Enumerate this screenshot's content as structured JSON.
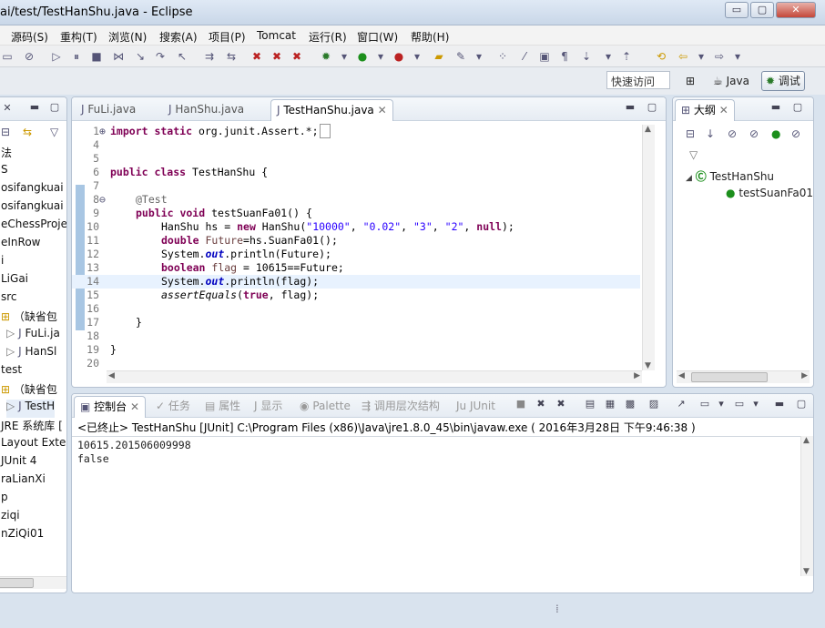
{
  "window": {
    "title": "ai/test/TestHanShu.java  -  Eclipse",
    "minimize_glyph": "▭",
    "maximize_glyph": "▢",
    "close_glyph": "✕"
  },
  "menu": [
    "源码(S)",
    "重构(T)",
    "浏览(N)",
    "搜索(A)",
    "项目(P)",
    "Tomcat",
    "运行(R)",
    "窗口(W)",
    "帮助(H)"
  ],
  "toolbar": {
    "quick_access": "快速访问"
  },
  "perspectives": {
    "java": "Java",
    "debug": "调试"
  },
  "explorer": {
    "items": [
      "法",
      "S",
      "osifangkuai",
      "osifangkuai",
      "eChessProjec",
      "eInRow",
      "i",
      "LiGai",
      "src",
      "（缺省包",
      "FuLi.ja",
      "HanSl",
      "test",
      "（缺省包",
      "TestH",
      "JRE 系统库 [",
      "Layout Exter",
      "JUnit 4",
      "raLianXi",
      "p",
      "ziqi",
      "nZiQi01"
    ]
  },
  "editor": {
    "tabs": [
      {
        "label": "FuLi.java"
      },
      {
        "label": "HanShu.java"
      },
      {
        "label": "TestHanShu.java"
      }
    ],
    "line_numbers": [
      "1",
      "4",
      "5",
      "6",
      "7",
      "8",
      "9",
      "10",
      "11",
      "12",
      "13",
      "14",
      "15",
      "16",
      "17",
      "18",
      "19",
      "20"
    ],
    "code": {
      "l1_kw": "import static",
      "l1_rest": " org.junit.Assert.*;",
      "l6_kw": "public class",
      "l6_rest": " TestHanShu {",
      "l8_ann": "@Test",
      "l9_kw": "public void",
      "l9_rest": " testSuanFa01() {",
      "l10_a": "HanShu hs = ",
      "l10_new": "new",
      "l10_b": " HanShu(",
      "l10_s1": "\"10000\"",
      "l10_c1": ", ",
      "l10_s2": "\"0.02\"",
      "l10_c2": ", ",
      "l10_s3": "\"3\"",
      "l10_c3": ", ",
      "l10_s4": "\"2\"",
      "l10_c4": ", ",
      "l10_null": "null",
      "l10_end": ");",
      "l11_kw": "double",
      "l11_var": " Future",
      "l11_rest": "=hs.SuanFa01();",
      "l12_a": "System.",
      "l12_out": "out",
      "l12_b": ".println(Future);",
      "l13_kw": "boolean",
      "l13_var": " flag",
      "l13_rest": " = 10615==Future;",
      "l14_a": "System.",
      "l14_out": "out",
      "l14_b": ".println(flag);",
      "l15_call": "assertEquals",
      "l15_a": "(",
      "l15_true": "true",
      "l15_b": ", flag);",
      "l17": "}",
      "l19": "}"
    }
  },
  "outline": {
    "tab": "大纲",
    "class_name": "TestHanShu",
    "method_name": "testSuanFa01"
  },
  "console": {
    "tabs": [
      "控制台",
      "任务",
      "属性",
      "显示",
      "Palette",
      "调用层次结构",
      "JUnit"
    ],
    "status": "<已终止> TestHanShu [JUnit] C:\\Program Files (x86)\\Java\\jre1.8.0_45\\bin\\javaw.exe ( 2016年3月28日 下午9:46:38 )",
    "output": [
      "10615.201506009998",
      "false"
    ]
  },
  "colors": {
    "keyword": "#7f0055",
    "string": "#2a00ff",
    "annotation": "#646464",
    "static_field": "#0000c0"
  }
}
